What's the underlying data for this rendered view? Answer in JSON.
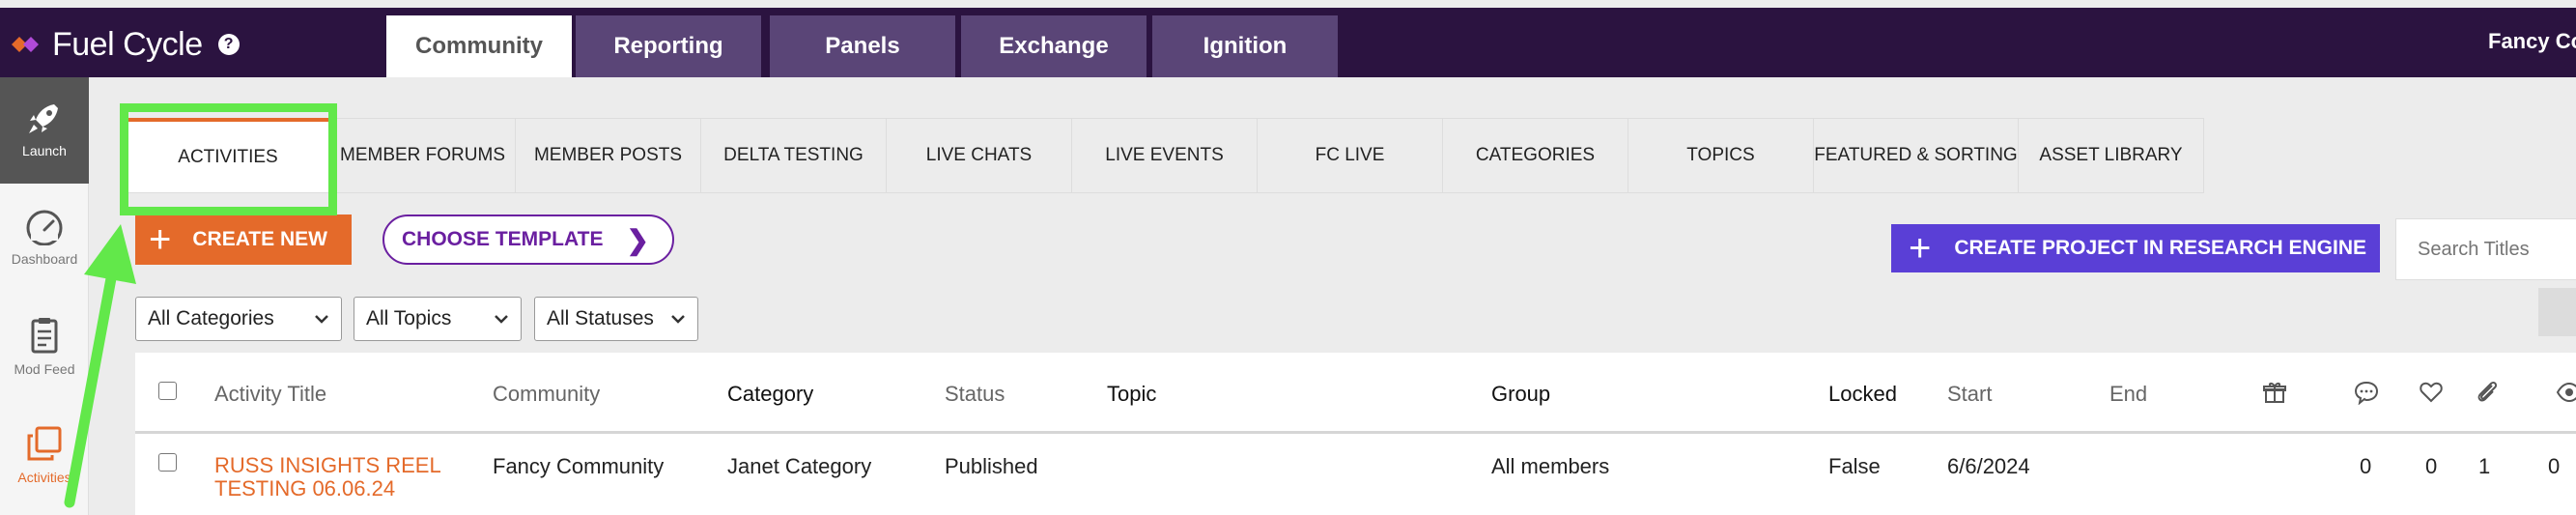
{
  "app": {
    "brand": "Fuel Cycle",
    "help_icon_text": "?",
    "account_name": "Fancy Co"
  },
  "colors": {
    "topbar": "#2b1340",
    "accent_orange": "#e46a2a",
    "purple": "#6a1fa0",
    "research_blue": "#5a3fd6",
    "highlight_green": "#62e84a"
  },
  "top_nav": [
    {
      "label": "Community",
      "active": true
    },
    {
      "label": "Reporting",
      "active": false
    },
    {
      "label": "Panels",
      "active": false
    },
    {
      "label": "Exchange",
      "active": false
    },
    {
      "label": "Ignition",
      "active": false
    }
  ],
  "sidebar": {
    "items": [
      {
        "label": "Launch",
        "icon": "rocket-icon"
      },
      {
        "label": "Dashboard",
        "icon": "gauge-icon"
      },
      {
        "label": "Mod Feed",
        "icon": "clipboard-icon"
      },
      {
        "label": "Activities",
        "icon": "copy-icon"
      }
    ]
  },
  "sub_tabs": [
    {
      "label": "ACTIVITIES",
      "active": true
    },
    {
      "label": "MEMBER FORUMS"
    },
    {
      "label": "MEMBER POSTS"
    },
    {
      "label": "DELTA TESTING"
    },
    {
      "label": "LIVE CHATS"
    },
    {
      "label": "LIVE EVENTS"
    },
    {
      "label": "FC LIVE"
    },
    {
      "label": "CATEGORIES"
    },
    {
      "label": "TOPICS"
    },
    {
      "label": "FEATURED & SORTING"
    },
    {
      "label": "ASSET LIBRARY"
    }
  ],
  "actions": {
    "create_new": "CREATE NEW",
    "choose_template": "CHOOSE TEMPLATE",
    "create_research": "CREATE PROJECT IN RESEARCH ENGINE",
    "search_placeholder": "Search Titles"
  },
  "filters": {
    "categories": "All Categories",
    "topics": "All Topics",
    "statuses": "All Statuses"
  },
  "table": {
    "columns": {
      "title": "Activity Title",
      "community": "Community",
      "category": "Category",
      "status": "Status",
      "topic": "Topic",
      "group": "Group",
      "locked": "Locked",
      "start": "Start",
      "end": "End"
    },
    "icon_columns": [
      "gift-icon",
      "comment-icon",
      "heart-icon",
      "paperclip-icon",
      "eye-icon"
    ],
    "rows": [
      {
        "title": "RUSS INSIGHTS REEL TESTING 06.06.24",
        "community": "Fancy Community",
        "category": "Janet Category",
        "status": "Published",
        "topic": "",
        "group": "All members",
        "locked": "False",
        "start": "6/6/2024",
        "end": "",
        "comments": "0",
        "likes": "0",
        "attachments": "1",
        "views": "0"
      }
    ]
  }
}
